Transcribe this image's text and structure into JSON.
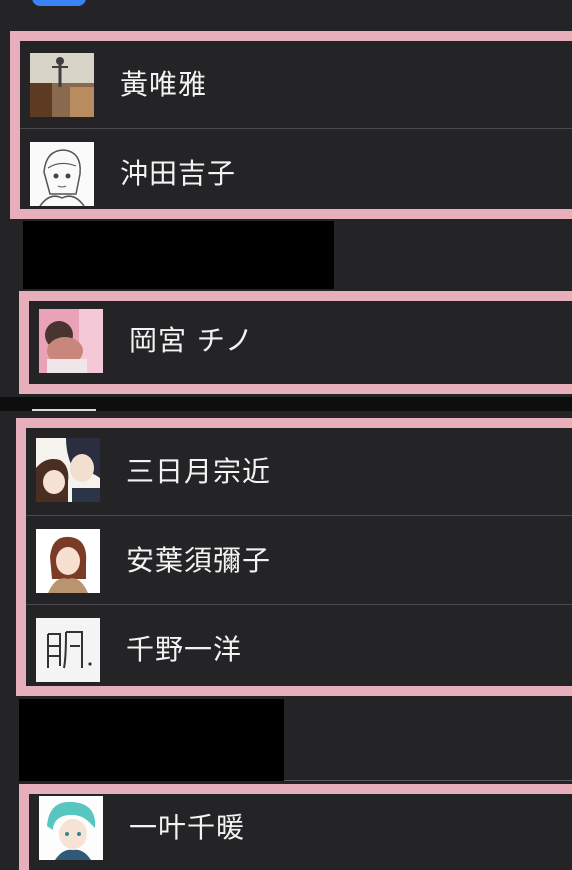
{
  "contacts": [
    {
      "name": "黃唯雅",
      "avatar": "room-photo"
    },
    {
      "name": "沖田吉子",
      "avatar": "anime-girl-sketch"
    },
    {
      "name": "岡宮 チノ",
      "avatar": "pink-photo"
    },
    {
      "name": "三日月宗近",
      "avatar": "anime-couple"
    },
    {
      "name": "安葉須彌子",
      "avatar": "anime-girl-brown"
    },
    {
      "name": "千野一洋",
      "avatar": "handwriting"
    },
    {
      "name": "一叶千暖",
      "avatar": "anime-boy-teal"
    }
  ],
  "colors": {
    "background": "#242426",
    "highlight_border": "#e7aebb",
    "accent_blue": "#3b82f6",
    "text": "#f3f3f3",
    "redaction": "#000000"
  }
}
